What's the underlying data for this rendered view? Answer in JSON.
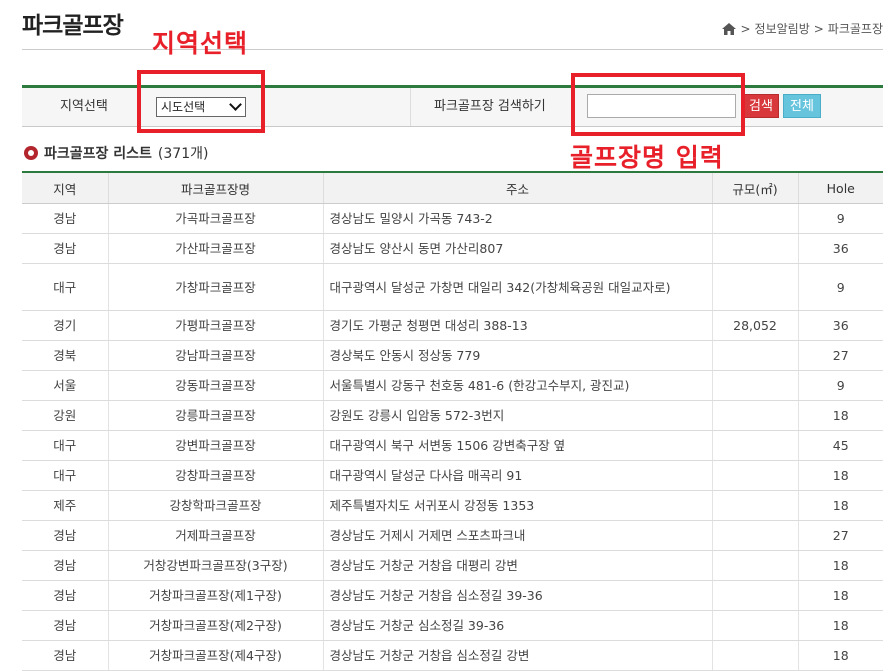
{
  "page": {
    "title": "파크골프장",
    "breadcrumb": [
      "정보알림방",
      "파크골프장"
    ],
    "separator": ">"
  },
  "annotations": {
    "region_label": "지역선택",
    "name_label": "골프장명 입력",
    "color": "#e8202a"
  },
  "search": {
    "region_label": "지역선택",
    "region_selected": "시도선택",
    "name_label": "파크골프장 검색하기",
    "name_value": "",
    "search_button": "검색",
    "all_button": "전체"
  },
  "list": {
    "heading": "파크골프장 리스트",
    "count": "(371개)"
  },
  "table": {
    "headers": [
      "지역",
      "파크골프장명",
      "주소",
      "규모(㎡)",
      "Hole"
    ],
    "rows": [
      [
        "경남",
        "가곡파크골프장",
        "경상남도 밀양시 가곡동 743-2",
        "",
        "9"
      ],
      [
        "경남",
        "가산파크골프장",
        "경상남도 양산시 동면 가산리807",
        "",
        "36"
      ],
      [
        "대구",
        "가창파크골프장",
        "대구광역시 달성군 가창면 대일리 342(가창체육공원 대일교자로)",
        "",
        "9"
      ],
      [
        "경기",
        "가평파크골프장",
        "경기도 가평군 청평면 대성리 388-13",
        "28,052",
        "36"
      ],
      [
        "경북",
        "강남파크골프장",
        "경상북도 안동시 정상동 779",
        "",
        "27"
      ],
      [
        "서울",
        "강동파크골프장",
        "서울특별시 강동구 천호동 481-6 (한강고수부지, 광진교)",
        "",
        "9"
      ],
      [
        "강원",
        "강릉파크골프장",
        "강원도 강릉시 입암동 572-3번지",
        "",
        "18"
      ],
      [
        "대구",
        "강변파크골프장",
        "대구광역시 북구 서변동 1506 강변축구장 옆",
        "",
        "45"
      ],
      [
        "대구",
        "강창파크골프장",
        "대구광역시 달성군 다사읍 매곡리 91",
        "",
        "18"
      ],
      [
        "제주",
        "강창학파크골프장",
        "제주특별자치도 서귀포시 강정동 1353",
        "",
        "18"
      ],
      [
        "경남",
        "거제파크골프장",
        "경상남도 거제시 거제면 스포츠파크내",
        "",
        "27"
      ],
      [
        "경남",
        "거창강변파크골프장(3구장)",
        "경상남도 거창군 거창읍 대평리 강변",
        "",
        "18"
      ],
      [
        "경남",
        "거창파크골프장(제1구장)",
        "경상남도 거창군 거창읍 심소정길 39-36",
        "",
        "18"
      ],
      [
        "경남",
        "거창파크골프장(제2구장)",
        "경상남도 거창군 심소정길 39-36",
        "",
        "18"
      ],
      [
        "경남",
        "거창파크골프장(제4구장)",
        "경상남도 거창군 거창읍 심소정길 강변",
        "",
        "18"
      ]
    ]
  }
}
